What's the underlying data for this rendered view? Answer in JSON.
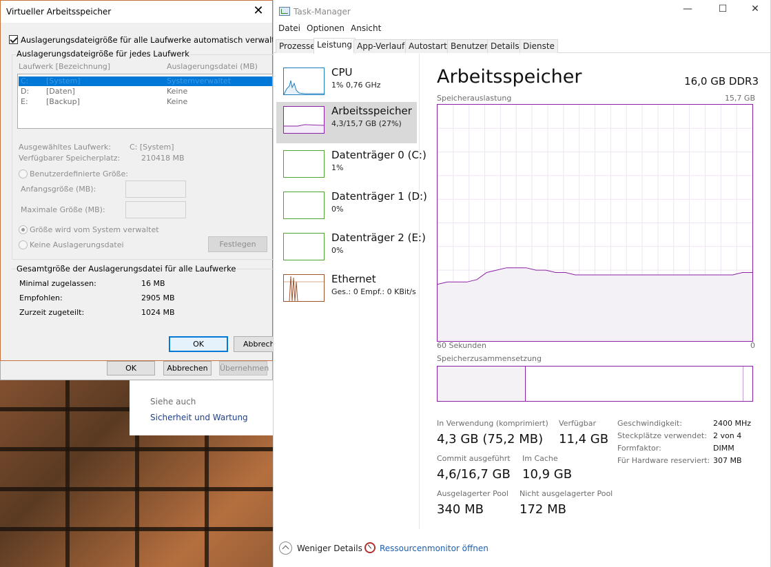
{
  "vm_dialog": {
    "title": "Virtueller Arbeitsspeicher",
    "close_glyph": "✕",
    "auto_manage_label": "Auslagerungsdateigröße für alle Laufwerke automatisch verwalten",
    "auto_manage_checked": true,
    "per_drive_group_title": "Auslagerungsdateigröße für jedes Laufwerk",
    "col_drive": "Laufwerk [Bezeichnung]",
    "col_pagefile": "Auslagerungsdatei (MB)",
    "drives": [
      {
        "letter": "C:",
        "label": "[System]",
        "pagefile": "Systemverwaltet"
      },
      {
        "letter": "D:",
        "label": "[Daten]",
        "pagefile": "Keine"
      },
      {
        "letter": "E:",
        "label": "[Backup]",
        "pagefile": "Keine"
      }
    ],
    "selected_drive_label": "Ausgewähltes Laufwerk:",
    "selected_drive_value": "C:  [System]",
    "free_space_label": "Verfügbarer Speicherplatz:",
    "free_space_value": "210418 MB",
    "custom_size_label": "Benutzerdefinierte Größe:",
    "initial_size_label": "Anfangsgröße (MB):",
    "max_size_label": "Maximale Größe (MB):",
    "system_managed_label": "Größe wird vom System verwaltet",
    "no_pagefile_label": "Keine Auslagerungsdatei",
    "set_button": "Festlegen",
    "total_group_title": "Gesamtgröße der Auslagerungsdatei für alle Laufwerke",
    "min_allowed_label": "Minimal zugelassen:",
    "min_allowed_value": "16 MB",
    "recommended_label": "Empfohlen:",
    "recommended_value": "2905 MB",
    "allocated_label": "Zurzeit zugeteilt:",
    "allocated_value": "1024 MB",
    "ok_button": "OK",
    "cancel_button": "Abbrech"
  },
  "sysprops": {
    "ok_button": "OK",
    "cancel_button": "Abbrechen",
    "apply_button": "Übernehmen"
  },
  "control_panel": {
    "see_also": "Siehe auch",
    "security_link": "Sicherheit und Wartung"
  },
  "task_manager": {
    "title": "Task-Manager",
    "window_controls": {
      "minimize": "—",
      "maximize": "☐",
      "close": "✕"
    },
    "menu": [
      "Datei",
      "Optionen",
      "Ansicht"
    ],
    "tabs": [
      "Prozesse",
      "Leistung",
      "App-Verlauf",
      "Autostart",
      "Benutzer",
      "Details",
      "Dienste"
    ],
    "active_tab": "Leistung",
    "resources": [
      {
        "name": "CPU",
        "sub": "1% 0,76 GHz",
        "color": "#1a7fc2"
      },
      {
        "name": "Arbeitsspeicher",
        "sub": "4,3/15,7 GB (27%)",
        "color": "#8b1fa8"
      },
      {
        "name": "Datenträger 0 (C:)",
        "sub": "1%",
        "color": "#4da430"
      },
      {
        "name": "Datenträger 1 (D:)",
        "sub": "0%",
        "color": "#4da430"
      },
      {
        "name": "Datenträger 2 (E:)",
        "sub": "0%",
        "color": "#4da430"
      },
      {
        "name": "Ethernet",
        "sub": "Ges.: 0 Empf.: 0 KBit/s",
        "color": "#a0522d"
      }
    ],
    "memory": {
      "title": "Arbeitsspeicher",
      "total": "16,0 GB DDR3",
      "usage_caption": "Speicherauslastung",
      "usage_max": "15,7 GB",
      "time_left": "60 Sekunden",
      "time_right": "0",
      "composition_caption": "Speicherzusammensetzung",
      "in_use_label": "In Verwendung (komprimiert)",
      "in_use_value": "4,3 GB (75,2 MB)",
      "available_label": "Verfügbar",
      "available_value": "11,4 GB",
      "commit_label": "Commit ausgeführt",
      "commit_value": "4,6/16,7 GB",
      "cached_label": "Im Cache",
      "cached_value": "10,9 GB",
      "paged_pool_label": "Ausgelagerter Pool",
      "paged_pool_value": "340 MB",
      "nonpaged_pool_label": "Nicht ausgelagerter Pool",
      "nonpaged_pool_value": "172 MB",
      "speed_label": "Geschwindigkeit:",
      "speed_value": "2400 MHz",
      "slots_label": "Steckplätze verwendet:",
      "slots_value": "2 von 4",
      "form_factor_label": "Formfaktor:",
      "form_factor_value": "DIMM",
      "hw_reserved_label": "Für Hardware reserviert:",
      "hw_reserved_value": "307 MB",
      "usage_history_fraction": [
        0.24,
        0.25,
        0.25,
        0.25,
        0.26,
        0.29,
        0.3,
        0.31,
        0.31,
        0.31,
        0.3,
        0.3,
        0.29,
        0.29,
        0.28,
        0.28,
        0.28,
        0.28,
        0.28,
        0.28,
        0.28,
        0.28,
        0.28,
        0.28,
        0.28,
        0.28,
        0.28,
        0.28,
        0.28,
        0.28,
        0.28,
        0.29,
        0.29
      ],
      "composition_in_use_fraction": 0.28,
      "composition_modified_fraction": 0.03
    },
    "footer": {
      "less_details": "Weniger Details",
      "resmon_link": "Ressourcenmonitor öffnen"
    }
  }
}
